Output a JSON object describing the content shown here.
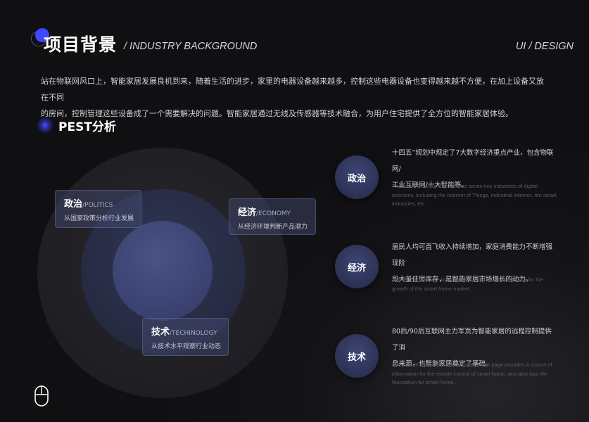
{
  "header": {
    "title": "项目背景",
    "subtitle": "/ INDUSTRY BACKGROUND",
    "corner_tag": "UI / DESIGN"
  },
  "intro": {
    "line1": "站在物联网风口上，智能家居发展良机到来，随着生活的进步，家里的电器设备越来越多，控制这些电器设备也变得越来越不方便，在加上设备又放在不同",
    "line2": "的房间，控制管理这些设备成了一个需要解决的问题。智能家居通过无线及传感器等技术融合，为用户住宅提供了全方位的智能家居体验。"
  },
  "section": {
    "title": "PEST分析"
  },
  "diagram": {
    "politics": {
      "title": "政治",
      "en": "/POLITICS",
      "desc": "从国家政策分析行业发展"
    },
    "economy": {
      "title": "经济",
      "en": "/ECONOMY",
      "desc": "从经济环境判断产品潜力"
    },
    "technology": {
      "title": "技术",
      "en": "/TECHINOLOGY",
      "desc": "从技术水平观察行业动态"
    }
  },
  "details": [
    {
      "label": "政治",
      "cn_line1": "十四五”规划中规定了7大数字经济重点产业，包含物联网/",
      "cn_line2": "工业互联网/十大智能等。",
      "en_line1": "The 14th Five-Year Plan defines seven key industries of digital",
      "en_line2": "economy, including the Internet of Things, industrial Internet, ten smart",
      "en_line3": "industries, etc."
    },
    {
      "label": "经济",
      "cn_line1": "居民人均可直飞收入持续增加，家庭消费能力不断增强现阶",
      "cn_line2": "段大量住房库存，是智能家居市场增长的动力。",
      "en_line1": "At present, the large housing inventory is the driving force for the",
      "en_line2": "growth of the smart home market."
    },
    {
      "label": "技术",
      "cn_line1": "80后/90后互联网主力军页为智能家居的远程控制提供了消",
      "cn_line2": "息来源，也智能家居奠定了基础。",
      "en_line1": "The post-80s/post-90s Internet main force page provides a source of",
      "en_line2": "information for the remote control of smart home, and also lays the",
      "en_line3": "foundation for smart home."
    }
  ],
  "colors": {
    "accent": "#3e49ff",
    "background": "#141417",
    "bubble": "#2f355a"
  },
  "icons": {
    "scroll": "mouse-icon"
  }
}
